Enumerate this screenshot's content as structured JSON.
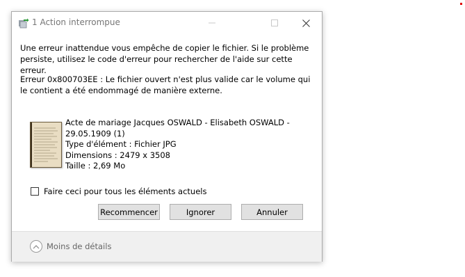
{
  "window": {
    "title": "1 Action interrompue"
  },
  "message": {
    "line1": "Une erreur inattendue vous empêche de copier le fichier. Si le problème persiste, utilisez le code d'erreur pour rechercher de l'aide sur cette erreur.",
    "line2": "Erreur 0x800703EE : Le fichier ouvert n'est plus valide car le volume qui le contient a été endommagé de manière externe."
  },
  "file": {
    "name_line1": "Acte de mariage Jacques OSWALD - Elisabeth OSWALD -",
    "name_line2": "29.05.1909 (1)",
    "type": "Type d'élément : Fichier JPG",
    "dimensions": "Dimensions : 2479 x 3508",
    "size": "Taille : 2,69 Mo"
  },
  "checkbox": {
    "label": "Faire ceci pour tous les éléments actuels",
    "checked": false
  },
  "buttons": {
    "restart": "Recommencer",
    "ignore": "Ignorer",
    "cancel": "Annuler"
  },
  "footer": {
    "details_toggle": "Moins de détails"
  },
  "icons": {
    "app": "copy-transfer-icon",
    "minimize": "minimize-icon",
    "maximize": "maximize-icon",
    "close": "close-icon",
    "details": "chevron-up-icon"
  }
}
